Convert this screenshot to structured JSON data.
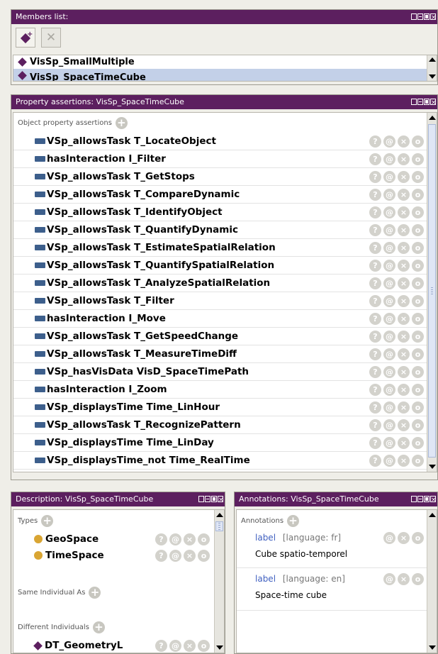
{
  "members": {
    "title": "Members list:",
    "items": [
      "VisSp_SmallMultiple",
      "VisSp_SpaceTimeCube"
    ],
    "selected_index": 1
  },
  "properties": {
    "title": "Property assertions: VisSp_SpaceTimeCube",
    "section_label": "Object property assertions",
    "items": [
      "VSp_allowsTask  T_LocateObject",
      "hasInteraction  I_Filter",
      "VSp_allowsTask  T_GetStops",
      "VSp_allowsTask  T_CompareDynamic",
      "VSp_allowsTask  T_IdentifyObject",
      "VSp_allowsTask  T_QuantifyDynamic",
      "VSp_allowsTask  T_EstimateSpatialRelation",
      "VSp_allowsTask  T_QuantifySpatialRelation",
      "VSp_allowsTask  T_AnalyzeSpatialRelation",
      "VSp_allowsTask  T_Filter",
      "hasInteraction  I_Move",
      "VSp_allowsTask  T_GetSpeedChange",
      "VSp_allowsTask  T_MeasureTimeDiff",
      "VSp_hasVisData  VisD_SpaceTimePath",
      "hasInteraction  I_Zoom",
      "VSp_displaysTime  Time_LinHour",
      "VSp_allowsTask  T_RecognizePattern",
      "VSp_displaysTime  Time_LinDay",
      "VSp_displaysTime_not  Time_RealTime"
    ]
  },
  "description": {
    "title": "Description: VisSp_SpaceTimeCube",
    "types_label": "Types",
    "types": [
      "GeoSpace",
      "TimeSpace"
    ],
    "same_label": "Same Individual As",
    "different_label": "Different Individuals",
    "different_items": [
      "DT_GeometryL"
    ]
  },
  "annotations": {
    "title": "Annotations: VisSp_SpaceTimeCube",
    "section_label": "Annotations",
    "items": [
      {
        "label": "label",
        "lang": "[language: fr]",
        "value": "Cube spatio-temporel"
      },
      {
        "label": "label",
        "lang": "[language: en]",
        "value": "Space-time cube"
      }
    ]
  },
  "buttons": {
    "help": "?",
    "annotate": "@",
    "delete": "×",
    "edit": "o",
    "add": "+"
  },
  "colors": {
    "title_bar": "#5c1f5f",
    "property_icon": "#3d5f8c",
    "class_dot": "#d9a533",
    "individual_diamond": "#5c1f5f",
    "selection": "#c3d0e8",
    "link_blue": "#4060c0"
  }
}
